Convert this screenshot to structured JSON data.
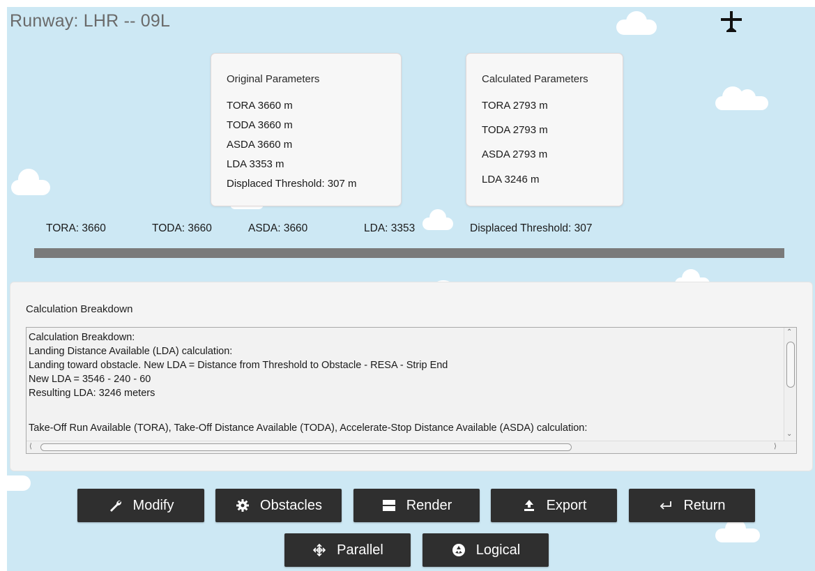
{
  "header": {
    "title": "Runway: LHR -- 09L"
  },
  "original_params": {
    "heading": "Original Parameters",
    "lines": [
      "TORA 3660 m",
      "TODA 3660 m",
      "ASDA 3660 m",
      "LDA 3353 m",
      "Displaced Threshold: 307 m"
    ]
  },
  "calculated_params": {
    "heading": "Calculated Parameters",
    "lines": [
      "TORA 2793 m",
      "TODA 2793 m",
      "ASDA 2793 m",
      "LDA 3246 m"
    ]
  },
  "runway_labels": [
    "TORA: 3660",
    "TODA: 3660",
    "ASDA: 3660",
    "LDA: 3353",
    "Displaced Threshold: 307"
  ],
  "breakdown": {
    "title": "Calculation Breakdown",
    "lines": [
      "Calculation Breakdown:",
      "Landing Distance Available (LDA) calculation:",
      "Landing toward obstacle. New LDA = Distance from Threshold to Obstacle - RESA - Strip End",
      "New LDA = 3546 - 240 - 60",
      "Resulting LDA: 3246 meters",
      "",
      "Take-Off Run Available (TORA), Take-Off Distance Available (TODA), Accelerate-Stop Distance Available (ASDA) calculation:"
    ]
  },
  "buttons": {
    "modify": "Modify",
    "obstacles": "Obstacles",
    "render": "Render",
    "export": "Export",
    "return": "Return",
    "parallel": "Parallel",
    "logical": "Logical"
  },
  "colors": {
    "sky": "#cde8f4",
    "button_bg": "#2f2f2f",
    "runway": "#7a7a7a"
  },
  "icons": [
    "plane-icon",
    "wrench-icon",
    "gear-icon",
    "render-icon",
    "upload-icon",
    "return-arrow-icon",
    "move-icon",
    "recycle-icon"
  ]
}
